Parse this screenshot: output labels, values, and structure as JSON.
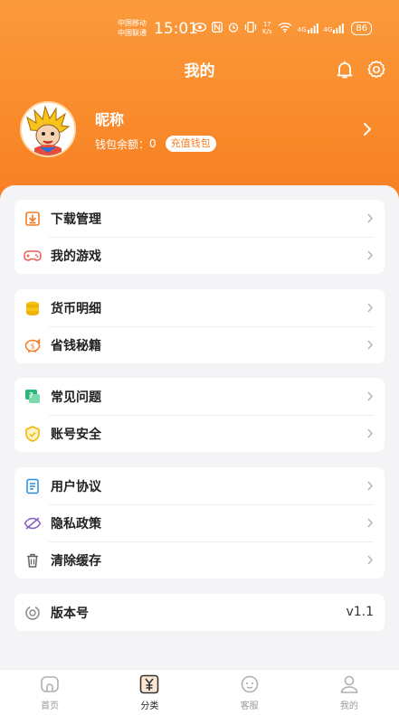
{
  "status_bar": {
    "carrier1": "中国移动",
    "carrier2": "中国联通",
    "time": "15:01",
    "net_speed_value": "17",
    "net_speed_unit": "K/s",
    "signal1": "4G",
    "signal2": "4G",
    "battery": "86"
  },
  "header": {
    "title": "我的"
  },
  "profile": {
    "nickname": "昵称",
    "wallet_label": "钱包余额：",
    "wallet_value": "0",
    "recharge_label": "充值钱包"
  },
  "menu": {
    "download": "下载管理",
    "games": "我的游戏",
    "currency": "货币明细",
    "tips": "省钱秘籍",
    "faq": "常见问题",
    "security": "账号安全",
    "agreement": "用户协议",
    "privacy": "隐私政策",
    "cache": "清除缓存",
    "version_label": "版本号",
    "version_value": "v1.1"
  },
  "tabbar": {
    "home": "首页",
    "category": "分类",
    "service": "客服",
    "mine": "我的"
  },
  "colors": {
    "accent": "#f77c22",
    "header_top": "#fb9a3c"
  }
}
